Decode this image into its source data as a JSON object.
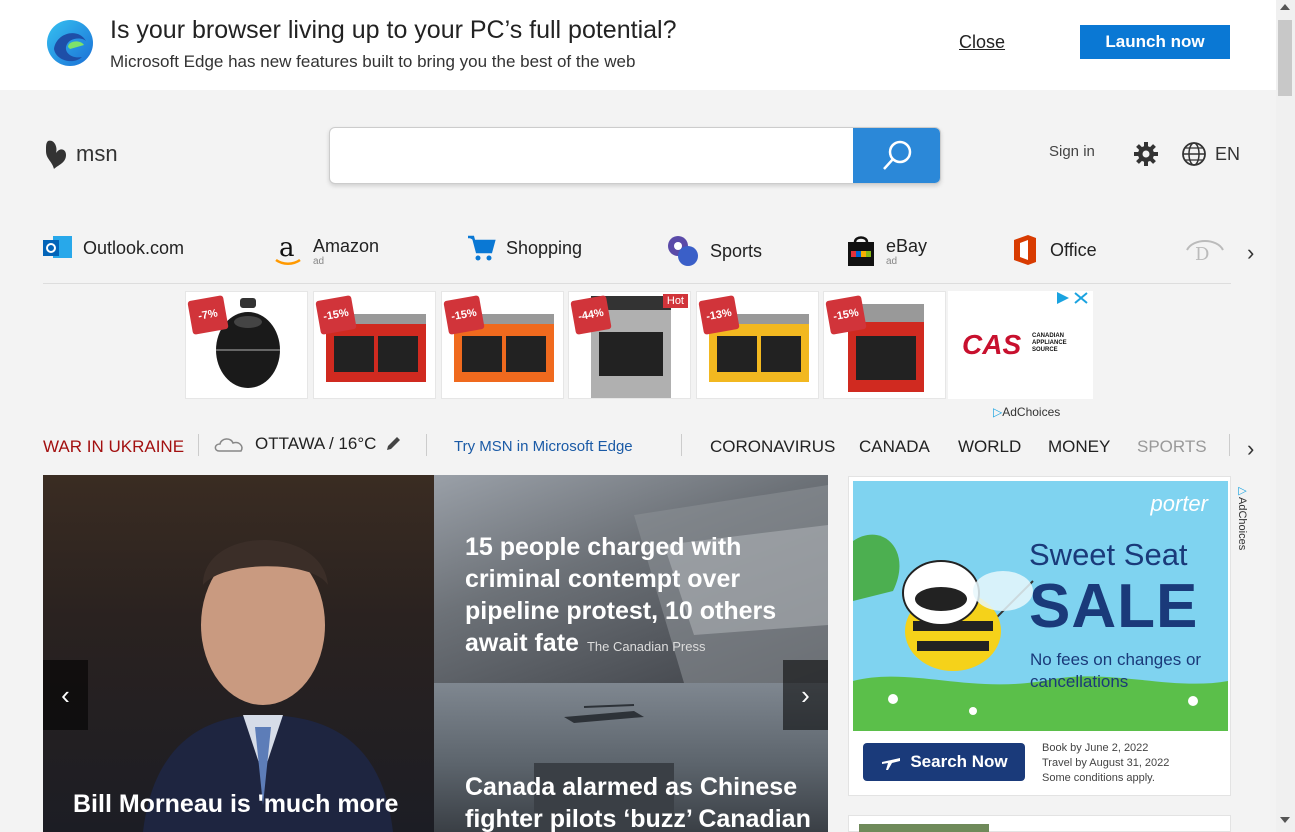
{
  "banner": {
    "title": "Is your browser living up to your PC’s full potential?",
    "subtitle": "Microsoft Edge has new features built to bring you the best of the web",
    "close_label": "Close",
    "launch_label": "Launch now"
  },
  "header": {
    "logo_text": "msn",
    "search_placeholder": "",
    "signin_label": "Sign in",
    "language_label": "EN"
  },
  "quicklinks": [
    {
      "label": "Outlook.com",
      "ad": ""
    },
    {
      "label": "Amazon",
      "ad": "ad"
    },
    {
      "label": "Shopping",
      "ad": ""
    },
    {
      "label": "Sports",
      "ad": ""
    },
    {
      "label": "eBay",
      "ad": "ad"
    },
    {
      "label": "Office",
      "ad": ""
    }
  ],
  "product_ads": {
    "tiles": [
      {
        "badge": "-7%"
      },
      {
        "badge": "-15%"
      },
      {
        "badge": "-15%"
      },
      {
        "badge": "-44%",
        "hot": "Hot"
      },
      {
        "badge": "-13%"
      },
      {
        "badge": "-15%"
      }
    ],
    "brand_text": "CAS",
    "brand_sub": "CANADIAN APPLIANCE SOURCE",
    "adchoices_label": "AdChoices"
  },
  "nav": {
    "war": "WAR IN UKRAINE",
    "weather": "OTTAWA / 16°C",
    "try_edge": "Try MSN in Microsoft Edge",
    "categories": [
      "CORONAVIRUS",
      "CANADA",
      "WORLD",
      "MONEY",
      "SPORTS"
    ]
  },
  "hero": {
    "main_title": "Bill Morneau is 'much more",
    "top_title": "15 people charged with criminal contempt over pipeline protest, 10 others await fate",
    "top_source": "The Canadian Press",
    "bottom_title": "Canada alarmed as Chinese fighter pilots ‘buzz’ Canadian"
  },
  "side_ad": {
    "brand": "porter",
    "headline1": "Sweet Seat",
    "headline2": "SALE",
    "body": "No fees on changes or cancellations",
    "cta": "Search Now",
    "terms_1": "Book by June 2, 2022",
    "terms_2": "Travel by August 31, 2022",
    "terms_3": "Some conditions apply.",
    "adchoices_label": "AdChoices"
  },
  "colors": {
    "edge_blue": "#0a78d4",
    "search_blue": "#2b88d8",
    "war_red": "#a31010",
    "link_blue": "#1a5aa6"
  }
}
